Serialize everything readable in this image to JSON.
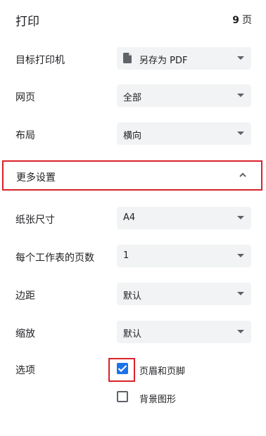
{
  "header": {
    "title": "打印",
    "page_count": "9",
    "page_unit": "页"
  },
  "settings": {
    "destination": {
      "label": "目标打印机",
      "value": "另存为 PDF",
      "icon": "file-icon"
    },
    "pages": {
      "label": "网页",
      "value": "全部"
    },
    "layout": {
      "label": "布局",
      "value": "横向"
    }
  },
  "more_settings": {
    "label": "更多设置",
    "expanded": true
  },
  "advanced": {
    "paper_size": {
      "label": "纸张尺寸",
      "value": "A4"
    },
    "pages_per_sheet": {
      "label": "每个工作表的页数",
      "value": "1"
    },
    "margins": {
      "label": "边距",
      "value": "默认"
    },
    "scale": {
      "label": "缩放",
      "value": "默认"
    }
  },
  "options": {
    "label": "选项",
    "headers_footers": {
      "label": "页眉和页脚",
      "checked": true
    },
    "background_graphics": {
      "label": "背景图形",
      "checked": false
    }
  },
  "colors": {
    "accent": "#1a73e8",
    "highlight": "#d9222a",
    "select_bg": "#f1f3f4"
  }
}
